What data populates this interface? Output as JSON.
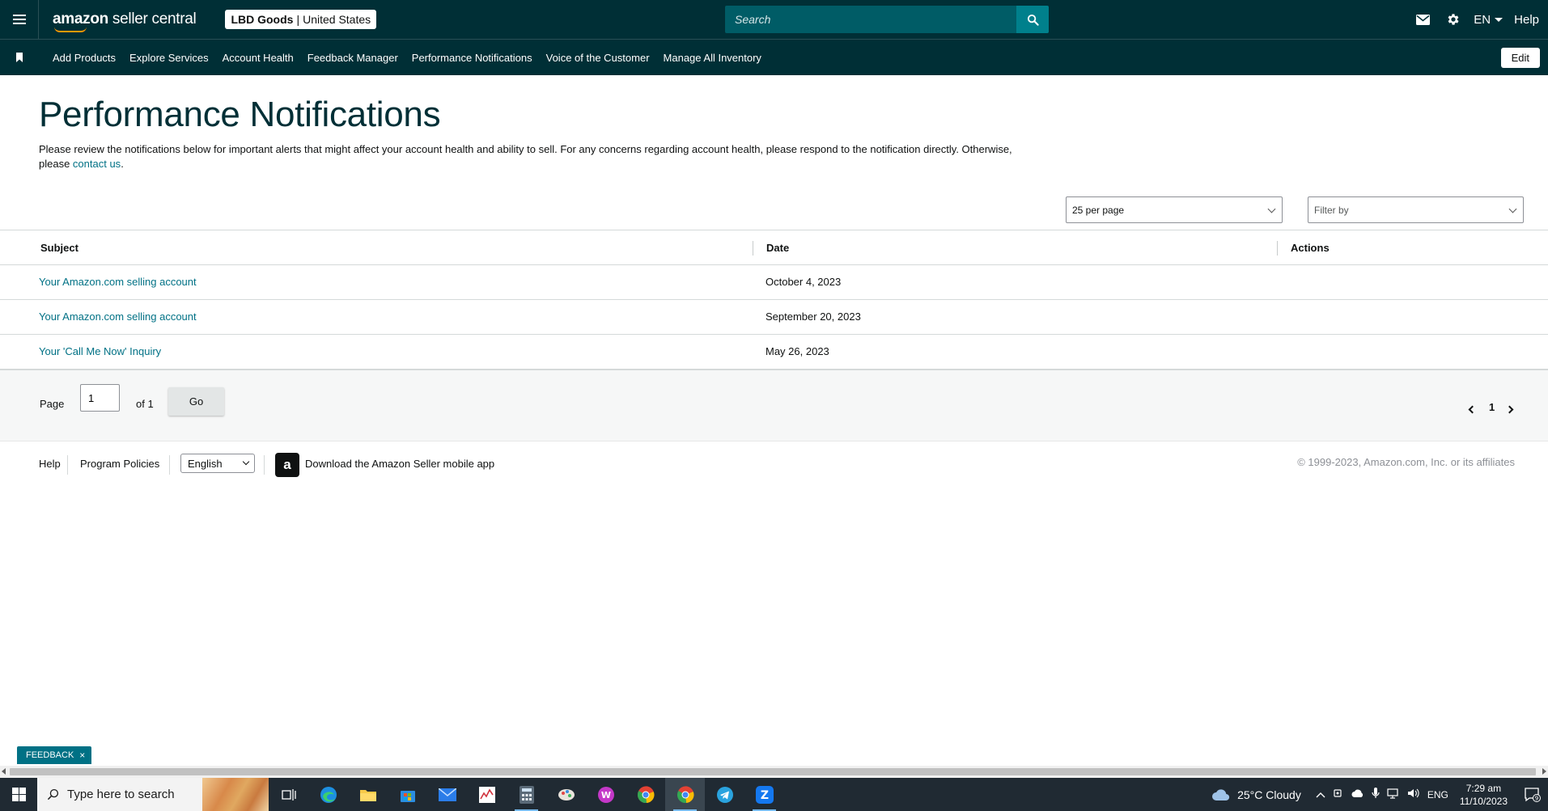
{
  "header": {
    "logo_bold": "amazon",
    "logo_rest": " seller central",
    "store_name": "LBD Goods",
    "store_sep": "|",
    "store_region": "United States",
    "search_placeholder": "Search",
    "language": "EN",
    "help": "Help"
  },
  "nav": {
    "items": [
      {
        "label": "Add Products"
      },
      {
        "label": "Explore Services"
      },
      {
        "label": "Account Health"
      },
      {
        "label": "Feedback Manager"
      },
      {
        "label": "Performance Notifications"
      },
      {
        "label": "Voice of the Customer"
      },
      {
        "label": "Manage All Inventory"
      }
    ],
    "edit": "Edit"
  },
  "main": {
    "title": "Performance Notifications",
    "intro_text": "Please review the notifications below for important alerts that might affect your account health and ability to sell. For any concerns regarding account health, please respond to the notification directly. Otherwise, please ",
    "intro_link": "contact us",
    "intro_end": ".",
    "per_page": "25 per page",
    "filter_placeholder": "Filter by"
  },
  "table": {
    "columns": [
      "Subject",
      "Date",
      "Actions"
    ],
    "rows": [
      {
        "subject": "Your Amazon.com selling account",
        "date": "October 4, 2023"
      },
      {
        "subject": "Your Amazon.com selling account",
        "date": "September 20, 2023"
      },
      {
        "subject": "Your 'Call Me Now' Inquiry",
        "date": "May 26, 2023"
      }
    ]
  },
  "pager": {
    "page_label": "Page",
    "page_value": "1",
    "of_label": "of 1",
    "go": "Go",
    "current": "1"
  },
  "footer": {
    "help": "Help",
    "program_policies": "Program Policies",
    "language": "English",
    "download_app": "Download the Amazon Seller mobile app",
    "app_icon_letter": "a",
    "copyright": "© 1999-2023, Amazon.com, Inc. or its affiliates"
  },
  "feedback_tab": {
    "label": "FEEDBACK",
    "close": "×"
  },
  "taskbar": {
    "search_placeholder": "Type here to search",
    "weather": "25°C  Cloudy",
    "input_lang": "ENG",
    "time": "7:29 am",
    "date": "11/10/2023",
    "notification_count": "9"
  },
  "colors": {
    "header_bg": "#002f36",
    "search_bg": "#005c66",
    "search_button": "#00808c",
    "link": "#007185",
    "taskbar_bg": "#202a33"
  }
}
